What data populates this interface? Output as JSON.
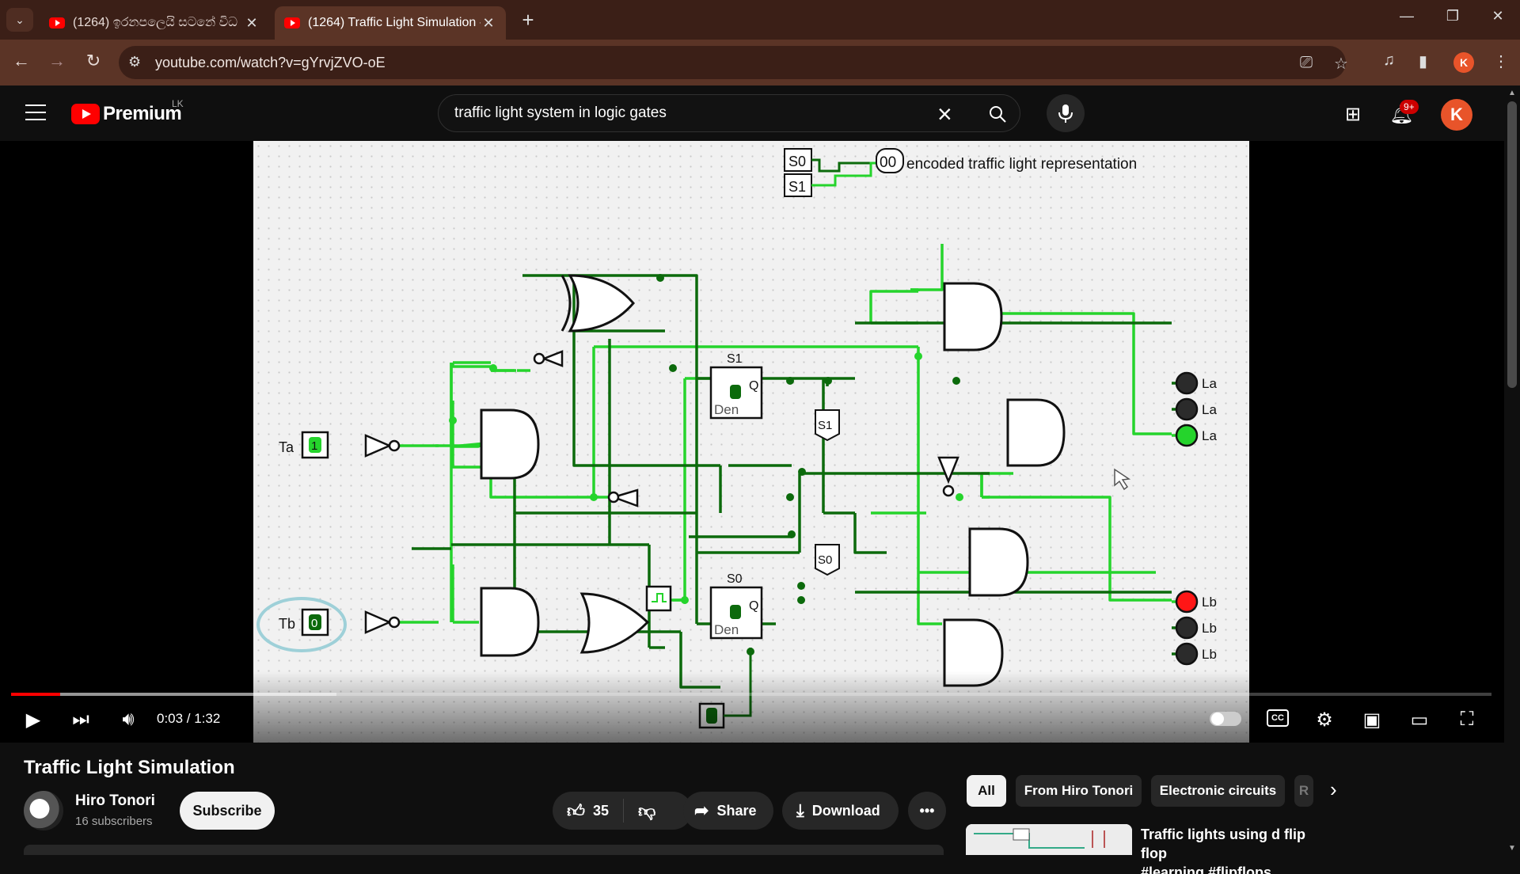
{
  "browser": {
    "tabs": [
      {
        "title": "(1264) ඉරනපලෙයි සටනේ විධ",
        "active": false
      },
      {
        "title": "(1264) Traffic Light Simulation -",
        "active": true
      }
    ],
    "url": "youtube.com/watch?v=gYrvjZVO-oE",
    "new_tab": "+",
    "profile_initial": "K"
  },
  "youtube": {
    "logo_text": "Premium",
    "country": "LK",
    "search_query": "traffic light system in logic gates",
    "notifications_badge": "9+",
    "avatar_initial": "K"
  },
  "video_frame": {
    "header_text": "encoded traffic light representation",
    "labels": {
      "s0": "S0",
      "s1": "S1",
      "code": "00",
      "ta": "Ta",
      "tb": "Tb",
      "one": "1",
      "zero": "0",
      "la": "La",
      "lb": "Lb",
      "q": "Q",
      "den": "Den",
      "s1_ff": "S1",
      "s0_ff": "S0",
      "s1_probe": "S1",
      "s0_probe": "S0"
    },
    "lights": {
      "la": [
        "off",
        "off",
        "green"
      ],
      "lb": [
        "red",
        "off",
        "off"
      ]
    },
    "colors": {
      "green": "#25d42c",
      "dark_green": "#0c6a0c",
      "red": "#ff1616",
      "off": "#2b2b2b"
    }
  },
  "player": {
    "current_time": "0:03",
    "duration": "1:32",
    "time_display": "0:03 / 1:32",
    "progress_played": 0.033,
    "progress_buffered": 0.22,
    "accent": "#ff0000"
  },
  "video": {
    "title": "Traffic Light Simulation",
    "channel": "Hiro Tonori",
    "subscribers": "16 subscribers",
    "subscribe_label": "Subscribe",
    "likes": "35",
    "share_label": "Share",
    "download_label": "Download"
  },
  "chips": [
    "All",
    "From Hiro Tonori",
    "Electronic circuits",
    "R"
  ],
  "recommendation": {
    "title": "Traffic lights using d flip flop",
    "title_line2": "#learning #flipflops #electroni"
  }
}
